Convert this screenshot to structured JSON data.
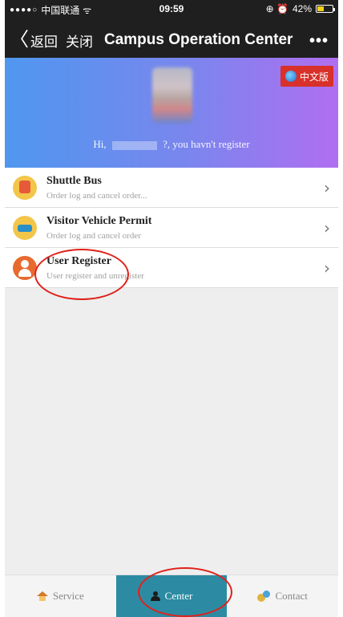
{
  "status_bar": {
    "signal": "●●●●○",
    "carrier": "中国联通",
    "wifi": "ᯤ",
    "time": "09:59",
    "battery_text": "42%",
    "battery_level": 0.42
  },
  "nav": {
    "back_label": "返回",
    "close_label": "关闭",
    "title": "Campus Operation Center",
    "more": "•••"
  },
  "banner": {
    "language_button": "中文版",
    "greeting_prefix": "Hi,",
    "greeting_suffix": "?,   you havn't register"
  },
  "menu": {
    "items": [
      {
        "title": "Shuttle Bus",
        "subtitle": "Order log and cancel order..."
      },
      {
        "title": "Visitor Vehicle Permit",
        "subtitle": "Order log and cancel order"
      },
      {
        "title": "User Register",
        "subtitle": "User register and unregister"
      }
    ]
  },
  "tabs": {
    "service": "Service",
    "center": "Center",
    "contact": "Contact"
  },
  "colors": {
    "nav_bg": "#1f1f1f",
    "active_tab": "#2c8ba3",
    "annotation": "#e0211a"
  }
}
